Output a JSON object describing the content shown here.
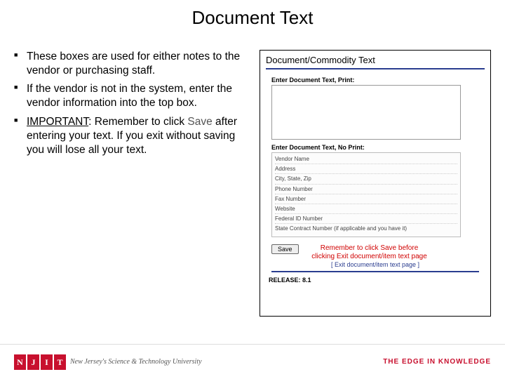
{
  "title": "Document Text",
  "bullets": {
    "b1": "These boxes are used for either notes to the vendor or purchasing staff.",
    "b2": "If the vendor is not in the system, enter the vendor information into the top box.",
    "b3_pre": "IMPORTANT",
    "b3_mid": ": Remember to click ",
    "b3_save": "Save",
    "b3_post": " after entering your text.  If you exit without saving you will lose all your text."
  },
  "panel": {
    "heading": "Document/Commodity Text",
    "label1": "Enter Document Text, Print:",
    "label2": "Enter Document Text, No Print:",
    "fields": {
      "f1": "Vendor Name",
      "f2": "Address",
      "f3": "City, State, Zip",
      "f4": "Phone Number",
      "f5": "Fax Number",
      "f6": "Website",
      "f7": "Federal ID Number",
      "f8": "State Contract Number (if applicable and you have it)"
    },
    "save_label": "Save",
    "callout": "Remember to click Save before clicking Exit document/item text page",
    "exit_link": "[ Exit document/item text page ]",
    "release": "RELEASE: 8.1"
  },
  "footer": {
    "mark": {
      "n": "N",
      "j": "J",
      "i": "I",
      "t": "T"
    },
    "univ": "New Jersey's Science & Technology University",
    "tagline": "THE EDGE IN KNOWLEDGE"
  }
}
